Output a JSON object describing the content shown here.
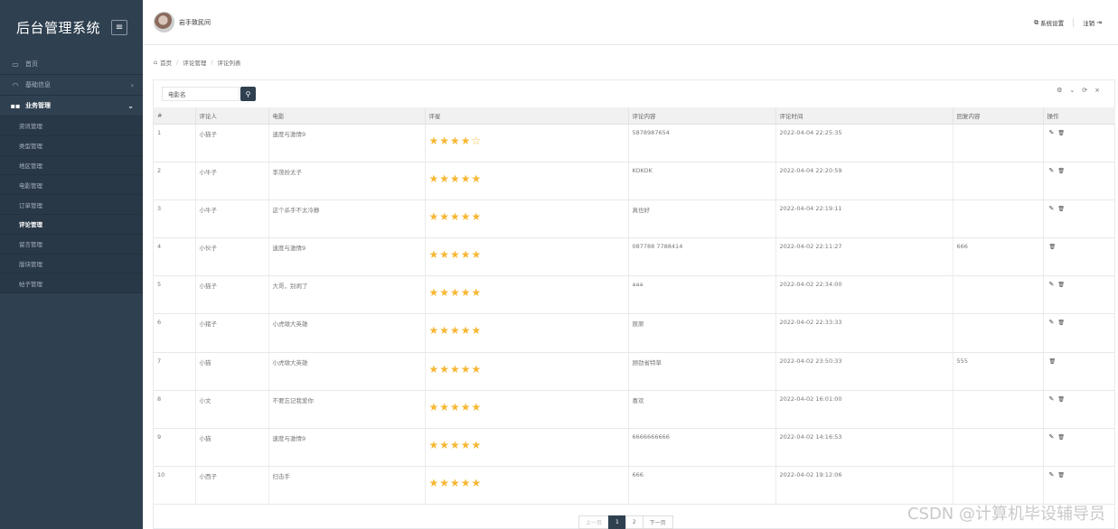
{
  "app": {
    "title": "后台管理系统",
    "menu_toggle_icon": "menu-icon"
  },
  "sidebar": {
    "items": [
      {
        "label": "首页",
        "icon": "monitor-icon"
      },
      {
        "label": "基础信息",
        "icon": "dashboard-icon",
        "arrow": "›"
      },
      {
        "label": "业务管理",
        "icon": "grid-icon",
        "arrow": "⌄"
      }
    ],
    "subitems": [
      {
        "label": "资讯管理"
      },
      {
        "label": "类型管理"
      },
      {
        "label": "地区管理"
      },
      {
        "label": "电影管理"
      },
      {
        "label": "订单管理"
      },
      {
        "label": "评论管理"
      },
      {
        "label": "留言管理"
      },
      {
        "label": "版块管理"
      },
      {
        "label": "帖子管理"
      }
    ]
  },
  "topbar": {
    "username": "岩手致民间",
    "settings_label": "系统设置",
    "logout_label": "注销"
  },
  "breadcrumb": {
    "home": "首页",
    "parent": "评论管理",
    "current": "评论列表"
  },
  "search": {
    "placeholder": "电影名",
    "value": "电影名"
  },
  "table": {
    "headers": [
      "#",
      "评论人",
      "电影",
      "评星",
      "评论内容",
      "评论时间",
      "回复内容",
      "操作"
    ],
    "rows": [
      {
        "num": "1",
        "user": "小猫子",
        "movie": "速度与激情9",
        "rating": 4,
        "content": "5878987654",
        "time": "2022-04-04 22:25:35",
        "reply": "",
        "editable": true
      },
      {
        "num": "2",
        "user": "小牛子",
        "movie": "李茂扮太子",
        "rating": 5,
        "content": "KOKOK",
        "time": "2022-04-04 22:20:59",
        "reply": "",
        "editable": true
      },
      {
        "num": "3",
        "user": "小牛子",
        "movie": "这个杀手不太冷静",
        "rating": 5,
        "content": "真也好",
        "time": "2022-04-04 22:19:11",
        "reply": "",
        "editable": true
      },
      {
        "num": "4",
        "user": "小伙子",
        "movie": "速度与激情9",
        "rating": 5,
        "content": "087788 7788414",
        "time": "2022-04-02 22:11:27",
        "reply": "666",
        "editable": false
      },
      {
        "num": "5",
        "user": "小猫子",
        "movie": "大哥，别闹了",
        "rating": 5,
        "content": "aaa",
        "time": "2022-04-02 22:34:00",
        "reply": "",
        "editable": true
      },
      {
        "num": "6",
        "user": "小猪子",
        "movie": "小虎墩大英雄",
        "rating": 5,
        "content": "原原",
        "time": "2022-04-02 22:33:33",
        "reply": "",
        "editable": true
      },
      {
        "num": "7",
        "user": "小猫",
        "movie": "小虎墩大英雄",
        "rating": 5,
        "content": "顾劲省特草",
        "time": "2022-04-02 23:50:33",
        "reply": "555",
        "editable": false
      },
      {
        "num": "8",
        "user": "小文",
        "movie": "不要忘记我爱你",
        "rating": 5,
        "content": "喜欢",
        "time": "2022-04-02 16:01:00",
        "reply": "",
        "editable": true
      },
      {
        "num": "9",
        "user": "小猫",
        "movie": "速度与激情9",
        "rating": 5,
        "content": "6666666666",
        "time": "2022-04-02 14:16:53",
        "reply": "",
        "editable": true
      },
      {
        "num": "10",
        "user": "小西子",
        "movie": "扫击手",
        "rating": 5,
        "content": "666",
        "time": "2022-04-02 19:12:06",
        "reply": "",
        "editable": true
      }
    ]
  },
  "pagination": {
    "prev": "上一页",
    "pages": [
      "1",
      "2"
    ],
    "current": "1",
    "next": "下一页"
  },
  "watermark": "CSDN @计算机毕设辅导员",
  "colors": {
    "sidebar": "#2f4050",
    "star": "#f7b733",
    "accent": "#2f4050"
  }
}
